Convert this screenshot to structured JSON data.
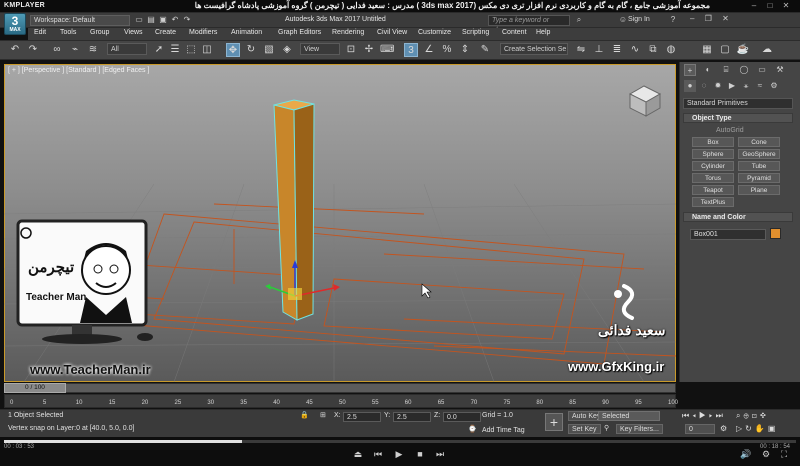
{
  "player": {
    "name": "KMPLAYER",
    "title": "مجموعه آموزشی جامع ، گام به گام و کاربردی نرم افزار تری دی مکس (3ds max 2017 ) مدرس : سعید فدایی ( تیچرمن ) گروه آموزشی پادشاه گرافیست ها",
    "current_time": "00 : 03 : 53",
    "total_time": "00 : 18 : 54",
    "progress": 0.3
  },
  "app": {
    "icon_label": "3",
    "icon_sub": "MAX",
    "workspace": "Workspace: Default",
    "window_title": "Autodesk 3ds Max 2017    Untitled",
    "search_placeholder": "Type a keyword or phrase",
    "sign_in": "Sign In"
  },
  "menus": [
    "Edit",
    "Tools",
    "Group",
    "Views",
    "Create",
    "Modifiers",
    "Animation",
    "Graph Editors",
    "Rendering",
    "Civil View",
    "Customize",
    "Scripting",
    "Content",
    "Help"
  ],
  "toolbar": {
    "filter": "All",
    "ref_coord": "View",
    "selection_set": "Create Selection Se"
  },
  "viewport": {
    "label": "[ + ] [Perspective ] [Standard ] [Edged Faces ]",
    "object_color": "#c8862a",
    "selection_color": "#6fe3e3"
  },
  "command_panel": {
    "category": "Standard Primitives",
    "object_type_title": "Object Type",
    "autogrid": "AutoGrid",
    "buttons": [
      "Box",
      "Cone",
      "Sphere",
      "GeoSphere",
      "Cylinder",
      "Tube",
      "Torus",
      "Pyramid",
      "Teapot",
      "Plane",
      "TextPlus"
    ],
    "name_color_title": "Name and Color",
    "object_name": "Box001",
    "object_color": "#e08f2e"
  },
  "timeline": {
    "slider": "0 / 100",
    "ticks": [
      "0",
      "5",
      "10",
      "15",
      "20",
      "25",
      "30",
      "35",
      "40",
      "45",
      "50",
      "55",
      "60",
      "65",
      "70",
      "75",
      "80",
      "85",
      "90",
      "95",
      "100"
    ]
  },
  "status": {
    "selected": "1 Object Selected",
    "prompt": "Vertex snap on Layer:0 at [40.0, 5.0, 0.0]",
    "x_label": "X:",
    "x_value": "2.5",
    "y_label": "Y:",
    "y_value": "2.5",
    "z_label": "Z:",
    "z_value": "0.0",
    "grid": "Grid = 1.0",
    "add_time_tag": "Add Time Tag",
    "auto_key": "Auto Key",
    "set_key": "Set Key",
    "selected_dd": "Selected",
    "key_filters": "Key Filters...",
    "frame": "0"
  },
  "watermarks": {
    "teacherman_url": "www.TeacherMan.ir",
    "gfxking_url": "www.GfxKing.ir",
    "fadaei": "سعید فدائی",
    "logo_title": "تیچرمن",
    "logo_sub": "Teacher Man"
  }
}
